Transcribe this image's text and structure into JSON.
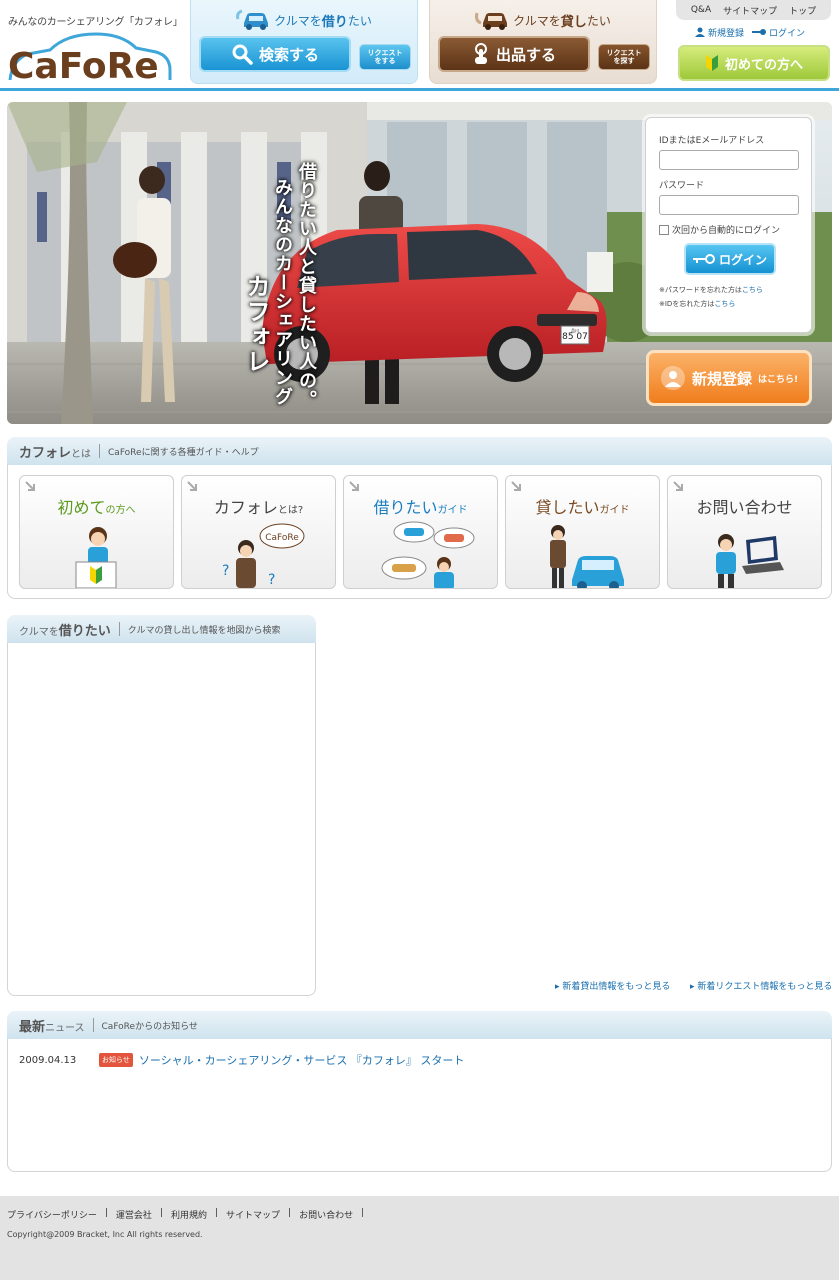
{
  "header": {
    "tagline": "みんなのカーシェアリング「カフォレ」",
    "logo_text": "CaFoRe",
    "rent": {
      "title_pre": "クルマを",
      "title_em": "借り",
      "title_post": "たい",
      "main_button": "検索する",
      "request_button_line1": "リクエスト",
      "request_button_line2": "をする"
    },
    "lend": {
      "title_pre": "クルマを",
      "title_em": "貸し",
      "title_post": "たい",
      "main_button": "出品する",
      "request_button_line1": "リクエスト",
      "request_button_line2": "を探す"
    },
    "util_links": [
      "Q&A",
      "サイトマップ",
      "トップ"
    ],
    "auth": {
      "register": "新規登録",
      "login": "ログイン"
    },
    "first_time_button": "初めての方へ"
  },
  "hero": {
    "copy_line1": "借りたい人と貸したい人の。",
    "copy_line2": "みんなのカーシェアリング",
    "copy_line3": "カフォレ",
    "plate_top": "品川",
    "plate_number": "85 07",
    "login": {
      "id_label": "IDまたはEメールアドレス",
      "id_value": "",
      "password_label": "パスワード",
      "password_value": "",
      "auto_login": "次回から自動的にログイン",
      "button": "ログイン",
      "forgot_password": "※パスワードを忘れた方は",
      "forgot_id": "※IDを忘れた方は",
      "here": "こちら"
    },
    "register": {
      "main": "新規登録",
      "sub": "はこちら!"
    }
  },
  "guide": {
    "title": "カフォレ",
    "title_small": "とは",
    "subtitle": "CaFoReに関する各種ガイド・ヘルプ",
    "cards": [
      {
        "title": "初めて",
        "title_small": "の方へ"
      },
      {
        "title": "カフォレ",
        "title_small": "とは?"
      },
      {
        "title": "借りたい",
        "title_small": "ガイド"
      },
      {
        "title": "貸したい",
        "title_small": "ガイド"
      },
      {
        "title": "お問い合わせ",
        "title_small": ""
      }
    ],
    "logo_badge": "CaFoRe"
  },
  "rent_map": {
    "title_pre": "クルマを",
    "title_em": "借りたい",
    "subtitle": "クルマの貸し出し情報を地図から検索",
    "more_lend": "新着貸出情報をもっと見る",
    "more_request": "新着リクエスト情報をもっと見る"
  },
  "news": {
    "title": "最新",
    "title_small": "ニュース",
    "subtitle": "CaFoReからのお知らせ",
    "items": [
      {
        "date": "2009.04.13",
        "badge": "お知らせ",
        "title": "ソーシャル・カーシェアリング・サービス 『カフォレ』 スタート"
      }
    ]
  },
  "footer": {
    "links": [
      "プライバシーポリシー",
      "運営会社",
      "利用規約",
      "サイトマップ",
      "お問い合わせ"
    ],
    "separator": "|",
    "copyright": "Copyright@2009 Bracket, Inc All rights reserved."
  },
  "colors": {
    "accent_blue": "#1a93d3",
    "accent_brown": "#5c3416",
    "accent_green": "#9ec83a",
    "accent_orange": "#f07d1c",
    "header_line": "#3fa6d9"
  }
}
